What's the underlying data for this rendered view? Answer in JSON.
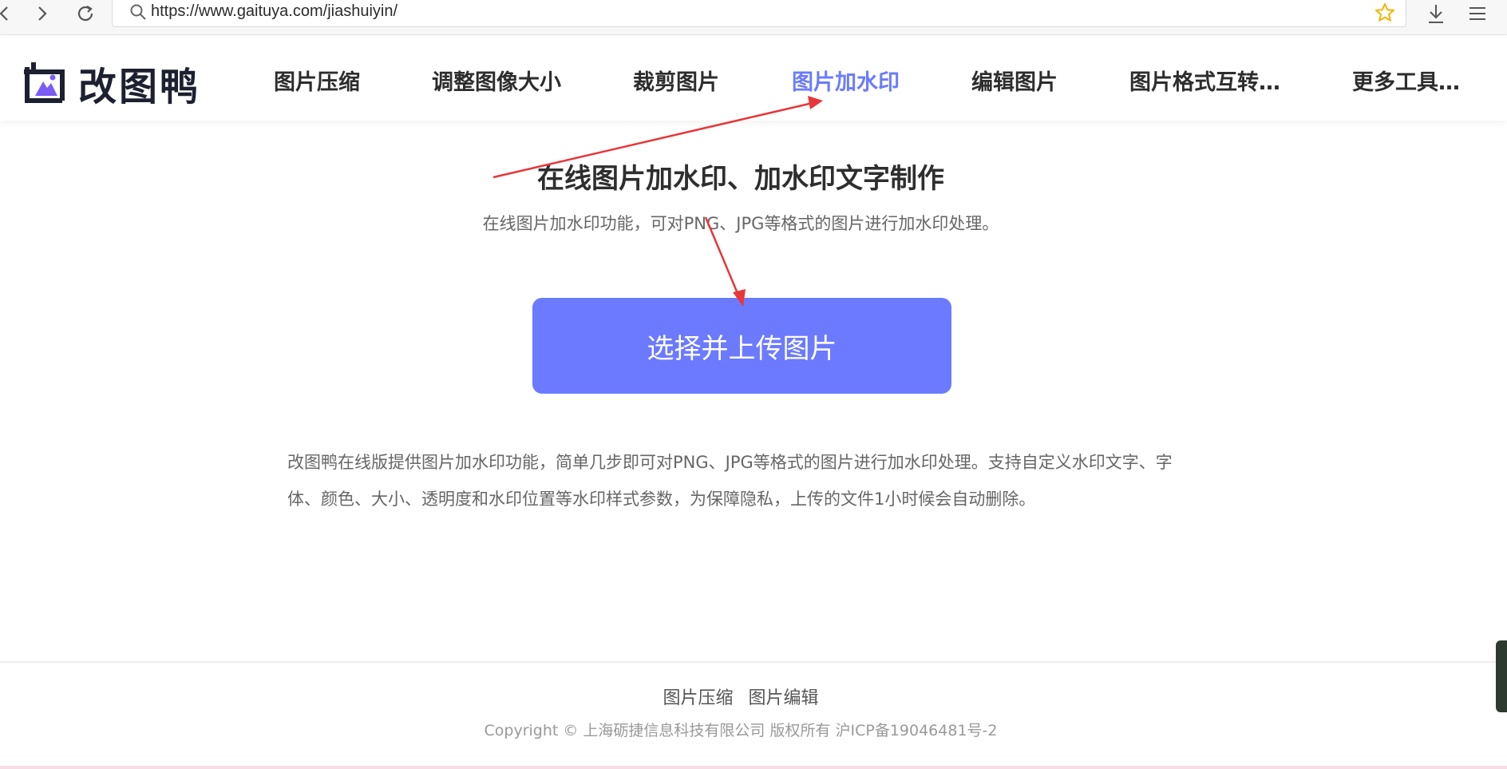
{
  "browser": {
    "url": "https://www.gaituya.com/jiashuiyin/",
    "icons": [
      "back-icon",
      "forward-icon",
      "reload-icon",
      "search-icon",
      "star-icon",
      "download-icon",
      "menu-icon"
    ]
  },
  "site": {
    "logo_text": "改图鸭",
    "nav": [
      {
        "label": "图片压缩",
        "active": false
      },
      {
        "label": "调整图像大小",
        "active": false
      },
      {
        "label": "裁剪图片",
        "active": false
      },
      {
        "label": "图片加水印",
        "active": true
      },
      {
        "label": "编辑图片",
        "active": false
      },
      {
        "label": "图片格式互转…",
        "active": false
      },
      {
        "label": "更多工具…",
        "active": false
      }
    ]
  },
  "main": {
    "title": "在线图片加水印、加水印文字制作",
    "subtitle": "在线图片加水印功能，可对PNG、JPG等格式的图片进行加水印处理。",
    "upload_label": "选择并上传图片",
    "description": "改图鸭在线版提供图片加水印功能，简单几步即可对PNG、JPG等格式的图片进行加水印处理。支持自定义水印文字、字体、颜色、大小、透明度和水印位置等水印样式参数，为保障隐私，上传的文件1小时候会自动删除。"
  },
  "footer": {
    "links": [
      "图片压缩",
      "图片编辑"
    ],
    "copyright": "Copyright © 上海砺捷信息科技有限公司 版权所有 沪ICP备19046481号-2"
  },
  "colors": {
    "accent": "#6b7afe",
    "nav_active": "#6a7cff",
    "annotation_arrow": "#e8363a",
    "star": "#f2b400"
  }
}
